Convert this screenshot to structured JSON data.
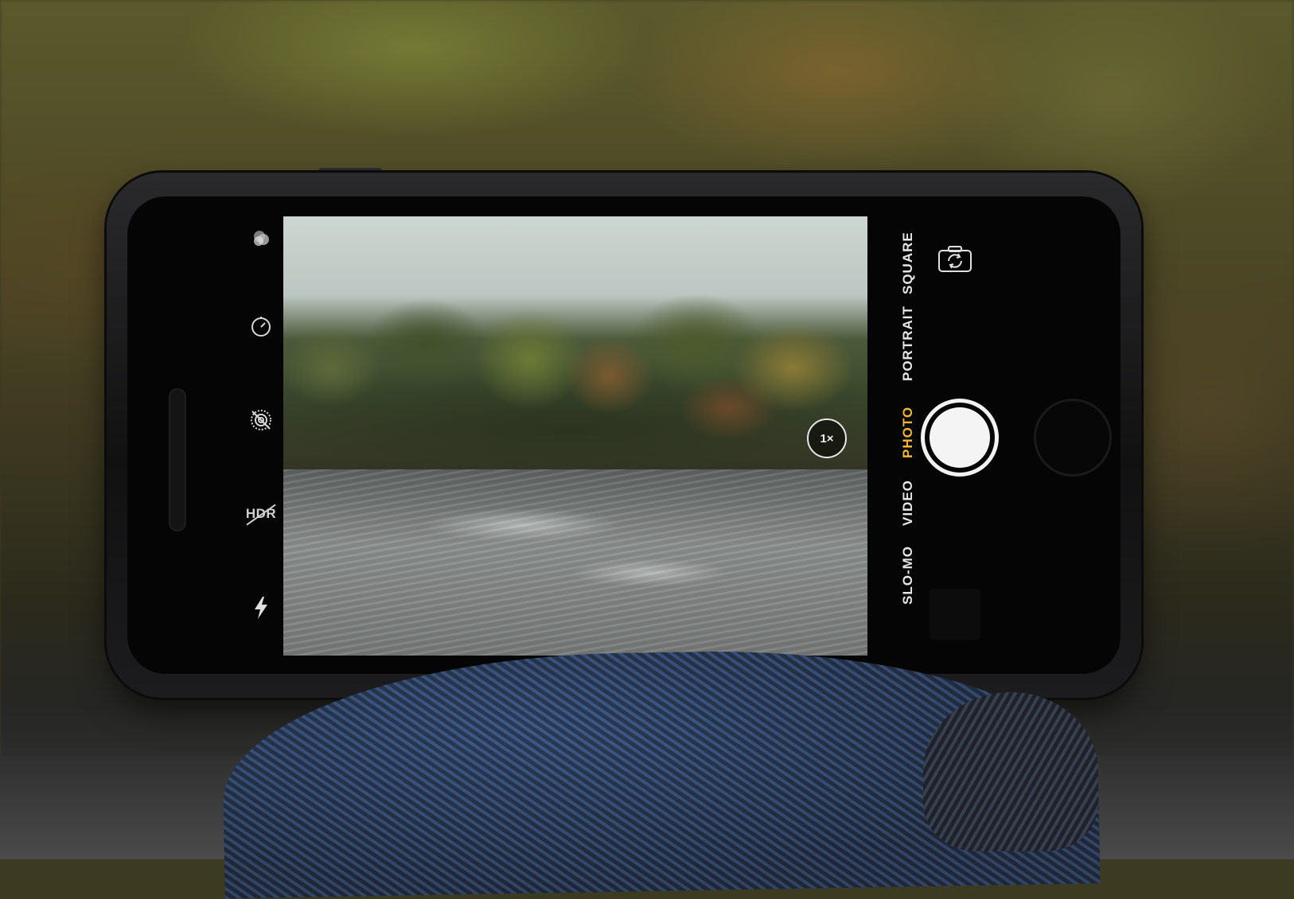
{
  "left_controls": {
    "hdr_label": "HDR"
  },
  "viewfinder": {
    "zoom_label": "1×"
  },
  "modes": {
    "slo_mo": "SLO-MO",
    "video": "VIDEO",
    "photo": "PHOTO",
    "portrait": "PORTRAIT",
    "square": "SQUARE",
    "active": "PHOTO"
  },
  "colors": {
    "active_mode": "#f2b632",
    "ui_text": "#e6e6e6"
  }
}
